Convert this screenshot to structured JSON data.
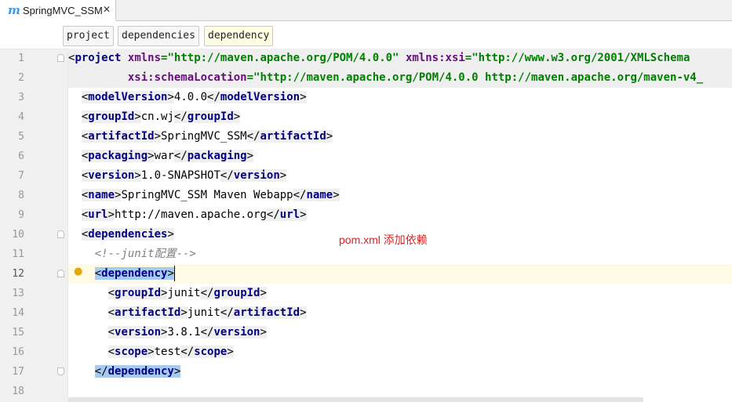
{
  "tab": {
    "icon": "m-maven-icon",
    "title": "SpringMVC_SSM",
    "close": "✕"
  },
  "breadcrumb": [
    "project",
    "dependencies",
    "dependency"
  ],
  "annotation": "pom.xml 添加依赖",
  "line_numbers": [
    "1",
    "2",
    "3",
    "4",
    "5",
    "6",
    "7",
    "8",
    "9",
    "10",
    "11",
    "12",
    "13",
    "14",
    "15",
    "16",
    "17",
    "18"
  ],
  "code": {
    "l1": {
      "open": "<",
      "tag": "project",
      "a1": "xmlns",
      "eq1": "=",
      "v1": "\"http://maven.apache.org/POM/4.0.0\"",
      "a2": "xmlns:xsi",
      "eq2": "=",
      "v2": "\"http://www.w3.org/2001/XMLSchema"
    },
    "l2": {
      "a": "xsi:schemaLocation",
      "eq": "=",
      "v": "\"http://maven.apache.org/POM/4.0.0 http://maven.apache.org/maven-v4_"
    },
    "l3": {
      "tag": "modelVersion",
      "text": "4.0.0"
    },
    "l4": {
      "tag": "groupId",
      "text": "cn.wj"
    },
    "l5": {
      "tag": "artifactId",
      "text": "SpringMVC_SSM"
    },
    "l6": {
      "tag": "packaging",
      "text": "war"
    },
    "l7": {
      "tag": "version",
      "text": "1.0-SNAPSHOT"
    },
    "l8": {
      "tag": "name",
      "text": "SpringMVC_SSM Maven Webapp"
    },
    "l9": {
      "tag": "url",
      "text": "http://maven.apache.org"
    },
    "l10": {
      "tag": "dependencies"
    },
    "l11": {
      "comment": "<!--junit配置-->"
    },
    "l12": {
      "tag": "dependency"
    },
    "l13": {
      "tag": "groupId",
      "text": "junit"
    },
    "l14": {
      "tag": "artifactId",
      "text": "junit"
    },
    "l15": {
      "tag": "version",
      "text": "3.8.1"
    },
    "l16": {
      "tag": "scope",
      "text": "test"
    },
    "l17": {
      "tag": "dependency"
    }
  },
  "colors": {
    "tag": "#000080",
    "attribute": "#0000ff",
    "namespace_attribute": "#660e7a",
    "value": "#008000",
    "comment": "#808080",
    "annotation": "#e02020",
    "selection": "#a6cbf3",
    "current_line": "#fffae3"
  }
}
